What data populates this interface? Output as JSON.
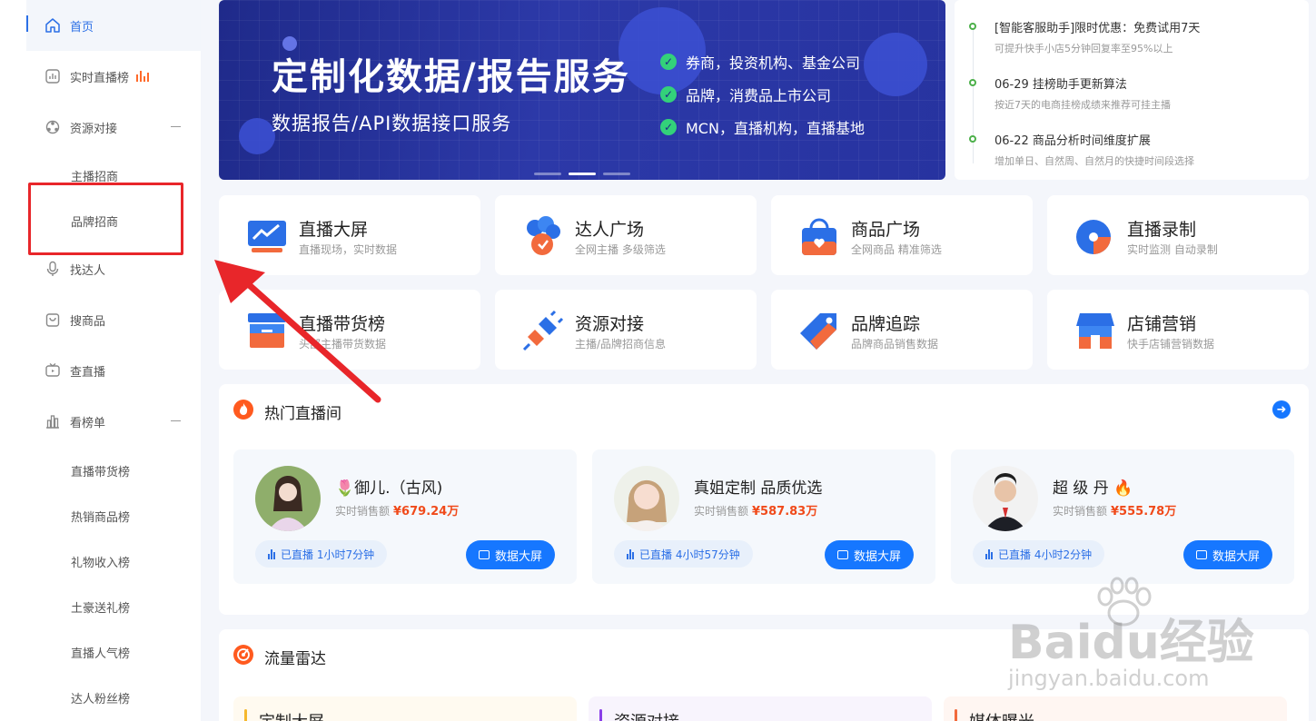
{
  "sidebar": {
    "items": [
      {
        "label": "首页",
        "icon": "home-icon",
        "active": true
      },
      {
        "label": "实时直播榜",
        "icon": "chart-box-icon"
      },
      {
        "label": "资源对接",
        "icon": "resource-icon",
        "expanded": true
      },
      {
        "label": "主播招商",
        "sub": true
      },
      {
        "label": "品牌招商",
        "sub": true
      },
      {
        "label": "找达人",
        "icon": "microphone-icon"
      },
      {
        "label": "搜商品",
        "icon": "bag-icon"
      },
      {
        "label": "查直播",
        "icon": "tv-icon"
      },
      {
        "label": "看榜单",
        "icon": "bar-chart-icon",
        "expanded": true
      },
      {
        "label": "直播带货榜",
        "sub": true
      },
      {
        "label": "热销商品榜",
        "sub": true
      },
      {
        "label": "礼物收入榜",
        "sub": true
      },
      {
        "label": "土豪送礼榜",
        "sub": true
      },
      {
        "label": "直播人气榜",
        "sub": true
      },
      {
        "label": "达人粉丝榜",
        "sub": true
      }
    ]
  },
  "banner": {
    "title": "定制化数据/报告服务",
    "subtitle": "数据报告/API数据接口服务",
    "points": [
      "券商，投资机构、基金公司",
      "品牌，消费品上市公司",
      "MCN，直播机构，直播基地"
    ]
  },
  "news": [
    {
      "title": "[智能客服助手]限时优惠：免费试用7天",
      "desc": "可提升快手小店5分钟回复率至95%以上"
    },
    {
      "title": "06-29 挂榜助手更新算法",
      "desc": "按近7天的电商挂榜成绩来推荐可挂主播"
    },
    {
      "title": "06-22 商品分析时间维度扩展",
      "desc": "增加单日、自然周、自然月的快捷时间段选择"
    }
  ],
  "features": [
    {
      "title": "直播大屏",
      "desc": "直播现场，实时数据"
    },
    {
      "title": "达人广场",
      "desc": "全网主播 多级筛选"
    },
    {
      "title": "商品广场",
      "desc": "全网商品 精准筛选"
    },
    {
      "title": "直播录制",
      "desc": "实时监测 自动录制"
    },
    {
      "title": "直播带货榜",
      "desc": "头部主播带货数据"
    },
    {
      "title": "资源对接",
      "desc": "主播/品牌招商信息"
    },
    {
      "title": "品牌追踪",
      "desc": "品牌商品销售数据"
    },
    {
      "title": "店铺营销",
      "desc": "快手店铺营销数据"
    }
  ],
  "hot_live": {
    "title": "热门直播间",
    "cards": [
      {
        "name": "🌷御儿.（古风)",
        "sales_label": "实时销售额",
        "sales": "¥679.24万",
        "status": "已直播 1小时7分钟",
        "button": "数据大屏"
      },
      {
        "name": "真姐定制 品质优选",
        "sales_label": "实时销售额",
        "sales": "¥587.83万",
        "status": "已直播 4小时57分钟",
        "button": "数据大屏"
      },
      {
        "name": "超 级 丹 🔥",
        "sales_label": "实时销售额",
        "sales": "¥555.78万",
        "status": "已直播 4小时2分钟",
        "button": "数据大屏"
      }
    ]
  },
  "radar": {
    "title": "流量雷达",
    "tabs": [
      "定制大屏",
      "资源对接",
      "媒体曝光"
    ]
  },
  "watermark": {
    "brand": "Baidu经验",
    "url": "jingyan.baidu.com"
  },
  "colors": {
    "accent": "#1677ff",
    "sales": "#f04a1a",
    "highlight": "#e8262a"
  }
}
